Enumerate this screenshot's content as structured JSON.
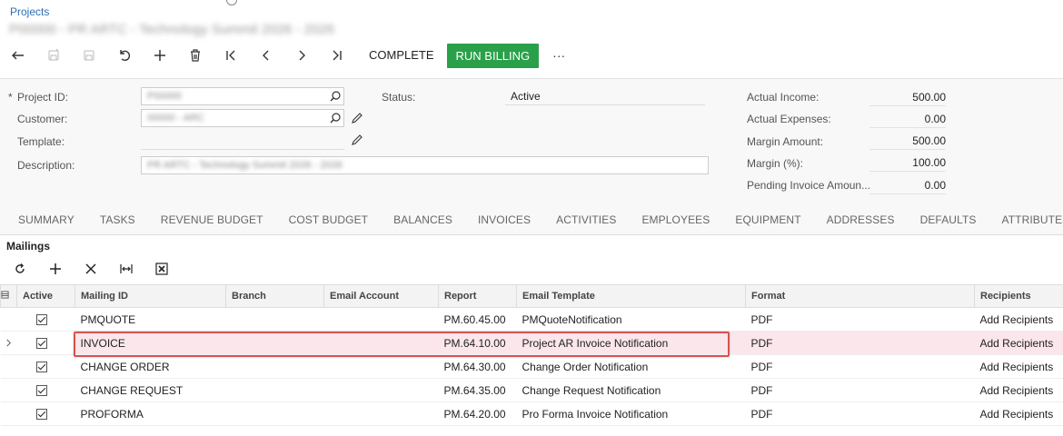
{
  "breadcrumb": "Projects",
  "blurred_title": "P00000 - PR ARTC - Technology Summit 2026 - 2026",
  "toolbar": {
    "complete_label": "COMPLETE",
    "run_billing_label": "RUN BILLING",
    "more_label": "···"
  },
  "form": {
    "project_id_label": "Project ID:",
    "customer_label": "Customer:",
    "template_label": "Template:",
    "description_label": "Description:",
    "status_label": "Status:",
    "status_value": "Active",
    "project_id_value": "P00000",
    "customer_value": "00000 - ARC",
    "description_value": "PR ARTC - Technology Summit 2026 - 2026",
    "required_mark": "*"
  },
  "summary": {
    "actual_income_label": "Actual Income:",
    "actual_income": "500.00",
    "actual_expenses_label": "Actual Expenses:",
    "actual_expenses": "0.00",
    "margin_amount_label": "Margin Amount:",
    "margin_amount": "500.00",
    "margin_pct_label": "Margin (%):",
    "margin_pct": "100.00",
    "pending_invoice_label": "Pending Invoice Amoun...",
    "pending_invoice": "0.00"
  },
  "tabs": [
    "SUMMARY",
    "TASKS",
    "REVENUE BUDGET",
    "COST BUDGET",
    "BALANCES",
    "INVOICES",
    "ACTIVITIES",
    "EMPLOYEES",
    "EQUIPMENT",
    "ADDRESSES",
    "DEFAULTS",
    "ATTRIBUTES"
  ],
  "mailings": {
    "title": "Mailings",
    "columns": [
      "Active",
      "Mailing ID",
      "Branch",
      "Email Account",
      "Report",
      "Email Template",
      "Format",
      "Recipients"
    ],
    "rows": [
      {
        "mailing_id": "PMQUOTE",
        "branch": "",
        "email_account": "",
        "report": "PM.60.45.00",
        "template": "PMQuoteNotification",
        "format": "PDF",
        "recipients": "Add Recipients"
      },
      {
        "mailing_id": "INVOICE",
        "branch": "",
        "email_account": "",
        "report": "PM.64.10.00",
        "template": "Project AR Invoice Notification",
        "format": "PDF",
        "recipients": "Add Recipients"
      },
      {
        "mailing_id": "CHANGE ORDER",
        "branch": "",
        "email_account": "",
        "report": "PM.64.30.00",
        "template": "Change Order Notification",
        "format": "PDF",
        "recipients": "Add Recipients"
      },
      {
        "mailing_id": "CHANGE REQUEST",
        "branch": "",
        "email_account": "",
        "report": "PM.64.35.00",
        "template": "Change Request Notification",
        "format": "PDF",
        "recipients": "Add Recipients"
      },
      {
        "mailing_id": "PROFORMA",
        "branch": "",
        "email_account": "",
        "report": "PM.64.20.00",
        "template": "Pro Forma Invoice Notification",
        "format": "PDF",
        "recipients": "Add Recipients"
      }
    ]
  },
  "colors": {
    "accent_green": "#2aa04a",
    "link_blue": "#2d6fb5",
    "selected_row": "#fbe6ec",
    "highlight_red": "#d9534f"
  }
}
